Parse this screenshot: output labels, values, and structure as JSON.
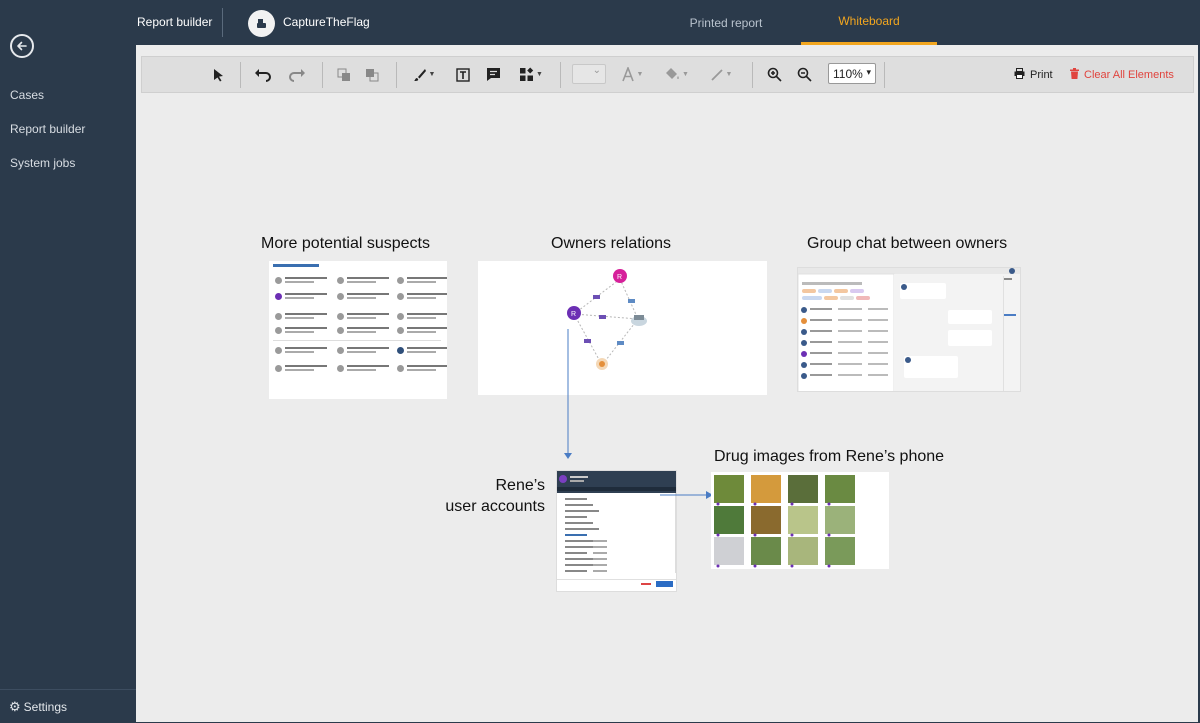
{
  "sidebar": {
    "items": [
      {
        "label": "Cases"
      },
      {
        "label": "Report builder"
      },
      {
        "label": "System jobs"
      }
    ],
    "footer_label": "Settings"
  },
  "topbar": {
    "app_title": "Report builder",
    "case_name": "CaptureTheFlag",
    "tabs": [
      {
        "label": "Printed report",
        "active": false
      },
      {
        "label": "Whiteboard",
        "active": true
      }
    ]
  },
  "toolbar": {
    "zoom_value": "110%",
    "print_label": "Print",
    "clear_label": "Clear All Elements"
  },
  "whiteboard": {
    "items": [
      {
        "title": "More potential suspects"
      },
      {
        "title": "Owners relations"
      },
      {
        "title": "Group chat between owners"
      },
      {
        "title": "Rene’s\nuser accounts"
      },
      {
        "title": "Drug images from Rene’s phone"
      }
    ]
  },
  "colors": {
    "sidebar_bg": "#2b3a4b",
    "active_tab": "#f2a61f",
    "canvas_bg": "#ececec",
    "danger": "#e0443e",
    "arrow": "#4a7cc4"
  }
}
